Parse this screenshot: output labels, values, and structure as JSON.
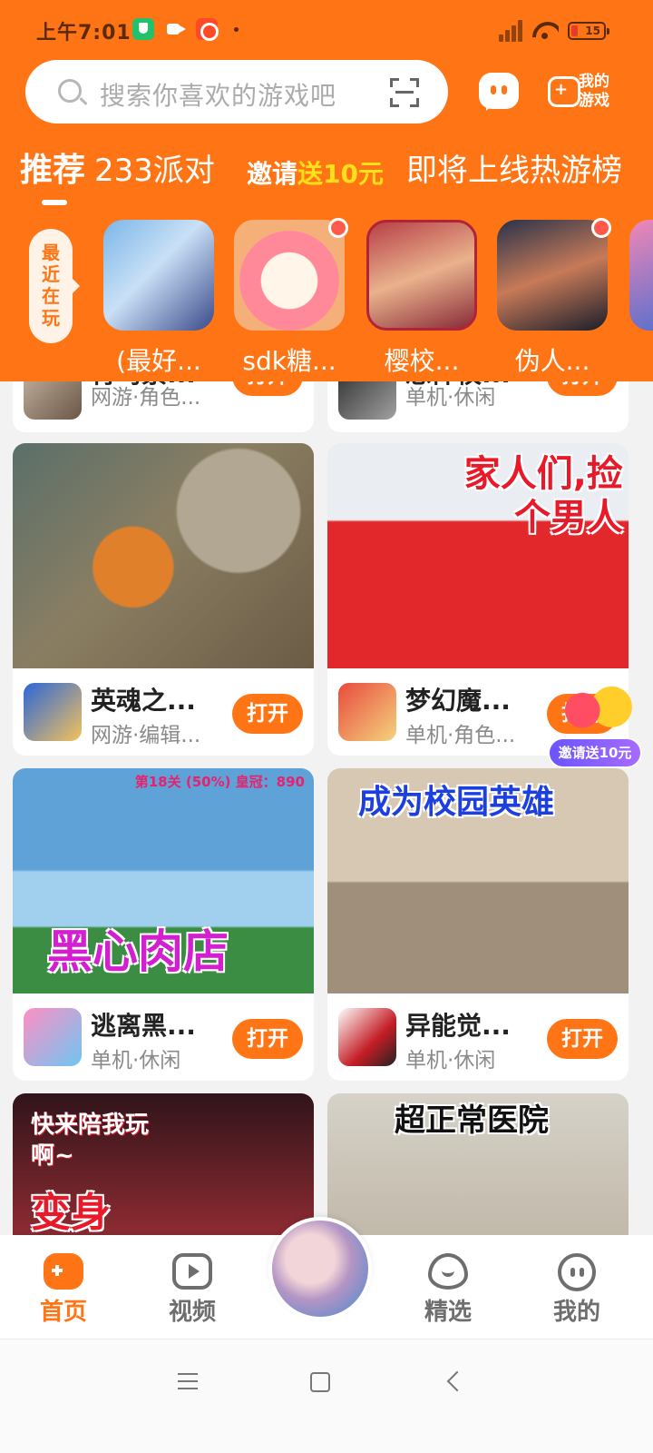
{
  "status_bar": {
    "time": "上午7:01",
    "battery": "15"
  },
  "search": {
    "placeholder": "搜索你喜欢的游戏吧"
  },
  "header": {
    "my_games_label": "我的游戏"
  },
  "tabs": [
    {
      "label": "推荐",
      "active": true
    },
    {
      "label": "233派对",
      "active": false
    },
    {
      "label": "邀请",
      "promo": true,
      "promo_amount": "送10元"
    },
    {
      "label": "即将上线",
      "active": false
    },
    {
      "label": "热游榜",
      "active": false
    }
  ],
  "recent": {
    "label": "最近在玩",
    "items": [
      {
        "name": "(最好...",
        "badge": false
      },
      {
        "name": "sdk糖...",
        "badge": true
      },
      {
        "name": "樱校...",
        "badge": false
      },
      {
        "name": "伪人...",
        "badge": true
      }
    ]
  },
  "cards": [
    {
      "title": "青鸟素...",
      "tags": "网游·角色...",
      "button": "打开"
    },
    {
      "title": "恐怖校...",
      "tags": "单机·休闲",
      "button": "打开"
    },
    {
      "title": "英魂之...",
      "tags": "网游·编辑...",
      "button": "打开"
    },
    {
      "title": "梦幻魔...",
      "tags": "单机·角色...",
      "button": "打开",
      "overlay": "家人们,捡个男人"
    },
    {
      "title": "逃离黑...",
      "tags": "单机·休闲",
      "button": "打开",
      "overlay": "黑心肉店",
      "hud": "第18关 (50%) 皇冠：890"
    },
    {
      "title": "异能觉...",
      "tags": "单机·休闲",
      "button": "打开",
      "overlay": "成为校园英雄"
    },
    {
      "overlay_top": "快来陪我玩啊~",
      "overlay": "变身"
    },
    {
      "overlay": "超正常医院"
    }
  ],
  "invite_float": {
    "label": "邀请送10元"
  },
  "bottom_nav": [
    {
      "label": "首页",
      "active": true,
      "icon": "gamepad-icon"
    },
    {
      "label": "视频",
      "active": false,
      "icon": "play-icon"
    },
    {
      "label": "精选",
      "active": false,
      "icon": "heart-icon"
    },
    {
      "label": "我的",
      "active": false,
      "icon": "face-icon"
    }
  ],
  "colors": {
    "brand": "#ff7414",
    "promo_yellow": "#ffe01a",
    "badge_red": "#ff5a4c"
  }
}
